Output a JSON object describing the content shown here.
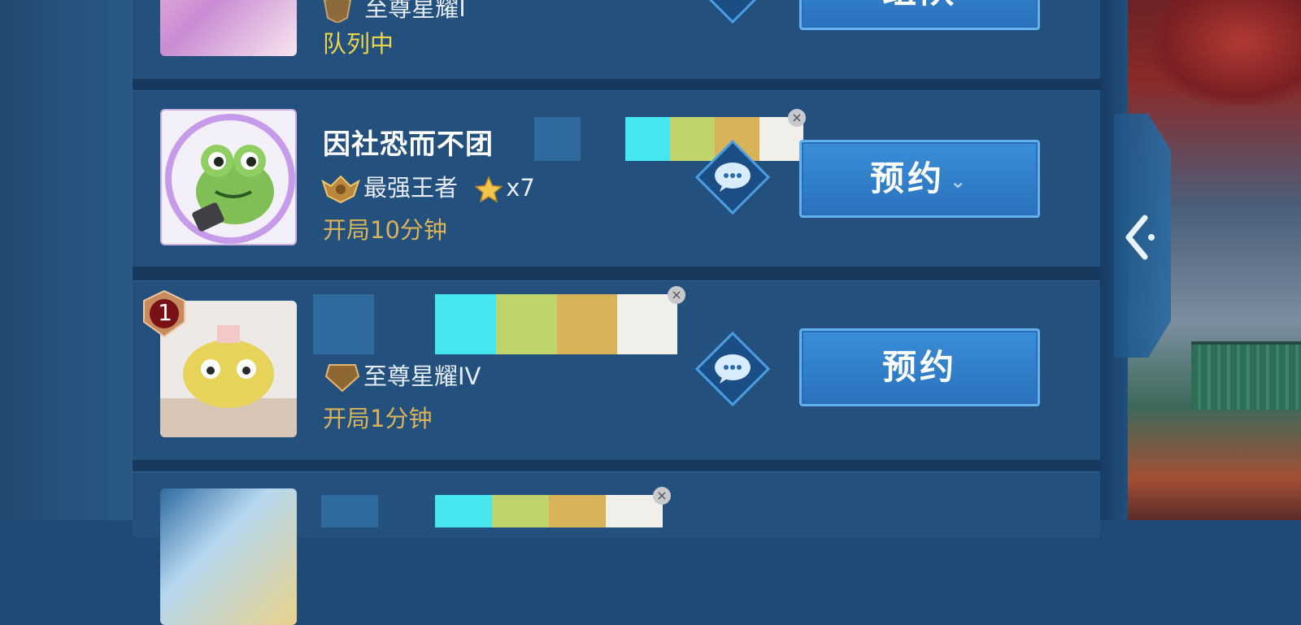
{
  "players": [
    {
      "name": "",
      "rank": "至尊星耀I",
      "status": "队列中",
      "action": "组队",
      "has_chevron": false
    },
    {
      "name": "因社恐而不团",
      "rank": "最强王者",
      "stars": "x7",
      "status": "开局10分钟",
      "action": "预约",
      "has_chevron": true,
      "chevron": "⌄"
    },
    {
      "badge_number": "1",
      "name": "",
      "rank_badge_text": "IV",
      "rank": "至尊星耀IV",
      "status": "开局1分钟",
      "action": "预约",
      "has_chevron": false
    }
  ],
  "close_symbol": "×",
  "colors": {
    "redaction": [
      "#2f6b9f",
      "#25527c",
      "#45e6ee",
      "#bfd46b",
      "#d9b35a",
      "#f1efe9"
    ],
    "button": "#2f80c9",
    "status_yellow": "#e9d44a",
    "status_gold": "#d9b25a"
  },
  "icons": [
    "chat-bubble-icon",
    "rank-badge-icon",
    "star-icon",
    "collapse-chevron-icon",
    "close-icon"
  ]
}
